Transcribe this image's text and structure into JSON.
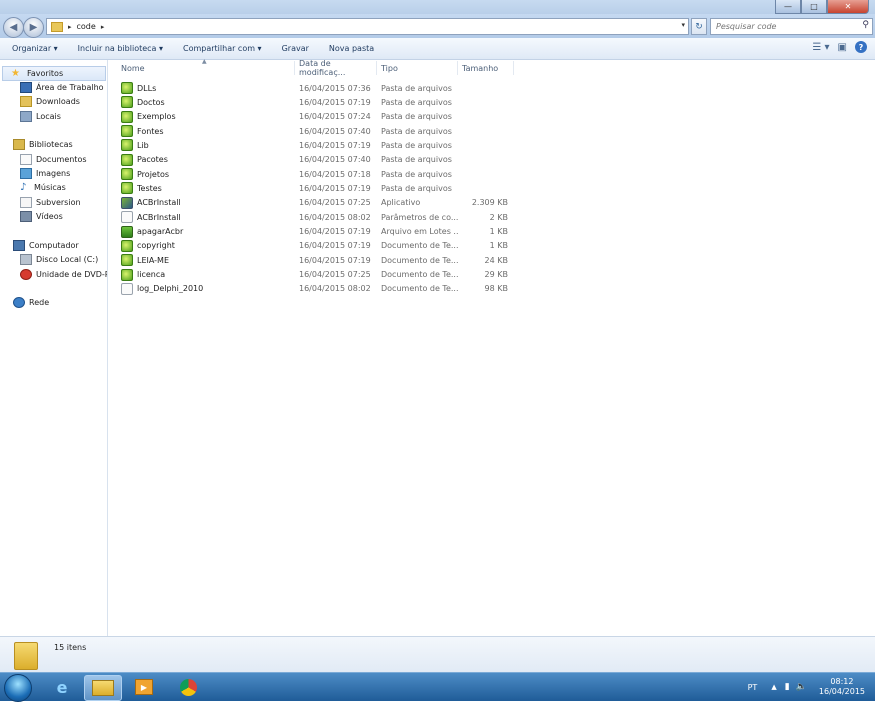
{
  "window": {
    "buttons": {
      "minimize": "—",
      "maximize": "□",
      "close": "✕"
    }
  },
  "navbar": {
    "back_icon": "back-arrow-icon",
    "forward_icon": "forward-arrow-icon",
    "breadcrumb_sep": "▸",
    "path": "code",
    "search_placeholder": "Pesquisar code"
  },
  "toolbar": {
    "organize": "Organizar ▾",
    "include_library": "Incluir na biblioteca ▾",
    "share": "Compartilhar com ▾",
    "burn": "Gravar",
    "new_folder": "Nova pasta",
    "help": "?"
  },
  "sidebar": {
    "favorites": "Favoritos",
    "desktop": "Área de Trabalho",
    "downloads": "Downloads",
    "recent": "Locais",
    "libraries": "Bibliotecas",
    "documents": "Documentos",
    "images": "Imagens",
    "music": "Músicas",
    "subversion": "Subversion",
    "videos": "Vídeos",
    "computer": "Computador",
    "local_disk": "Disco Local (C:)",
    "dvd_drive": "Unidade de DVD-RW",
    "network": "Rede"
  },
  "columns": {
    "name": "Nome",
    "date": "Data de modificaç...",
    "type": "Tipo",
    "size": "Tamanho"
  },
  "files": [
    {
      "name": "DLLs",
      "date": "16/04/2015 07:36",
      "type": "Pasta de arquivos",
      "size": "",
      "icon": "folder"
    },
    {
      "name": "Doctos",
      "date": "16/04/2015 07:19",
      "type": "Pasta de arquivos",
      "size": "",
      "icon": "folder"
    },
    {
      "name": "Exemplos",
      "date": "16/04/2015 07:24",
      "type": "Pasta de arquivos",
      "size": "",
      "icon": "folder"
    },
    {
      "name": "Fontes",
      "date": "16/04/2015 07:40",
      "type": "Pasta de arquivos",
      "size": "",
      "icon": "folder"
    },
    {
      "name": "Lib",
      "date": "16/04/2015 07:19",
      "type": "Pasta de arquivos",
      "size": "",
      "icon": "folder"
    },
    {
      "name": "Pacotes",
      "date": "16/04/2015 07:40",
      "type": "Pasta de arquivos",
      "size": "",
      "icon": "folder"
    },
    {
      "name": "Projetos",
      "date": "16/04/2015 07:18",
      "type": "Pasta de arquivos",
      "size": "",
      "icon": "folder"
    },
    {
      "name": "Testes",
      "date": "16/04/2015 07:19",
      "type": "Pasta de arquivos",
      "size": "",
      "icon": "folder"
    },
    {
      "name": "ACBrInstall",
      "date": "16/04/2015 07:25",
      "type": "Aplicativo",
      "size": "2.309 KB",
      "icon": "app"
    },
    {
      "name": "ACBrInstall",
      "date": "16/04/2015 08:02",
      "type": "Parâmetros de co...",
      "size": "2 KB",
      "icon": "doc"
    },
    {
      "name": "apagarAcbr",
      "date": "16/04/2015 07:19",
      "type": "Arquivo em Lotes ...",
      "size": "1 KB",
      "icon": "bat"
    },
    {
      "name": "copyright",
      "date": "16/04/2015 07:19",
      "type": "Documento de Te...",
      "size": "1 KB",
      "icon": "folder"
    },
    {
      "name": "LEIA-ME",
      "date": "16/04/2015 07:19",
      "type": "Documento de Te...",
      "size": "24 KB",
      "icon": "folder"
    },
    {
      "name": "licenca",
      "date": "16/04/2015 07:25",
      "type": "Documento de Te...",
      "size": "29 KB",
      "icon": "folder"
    },
    {
      "name": "log_Delphi_2010",
      "date": "16/04/2015 08:02",
      "type": "Documento de Te...",
      "size": "98 KB",
      "icon": "doc"
    }
  ],
  "status": {
    "count": "15 itens"
  },
  "taskbar": {
    "lang": "PT",
    "time": "08:12",
    "date": "16/04/2015"
  }
}
